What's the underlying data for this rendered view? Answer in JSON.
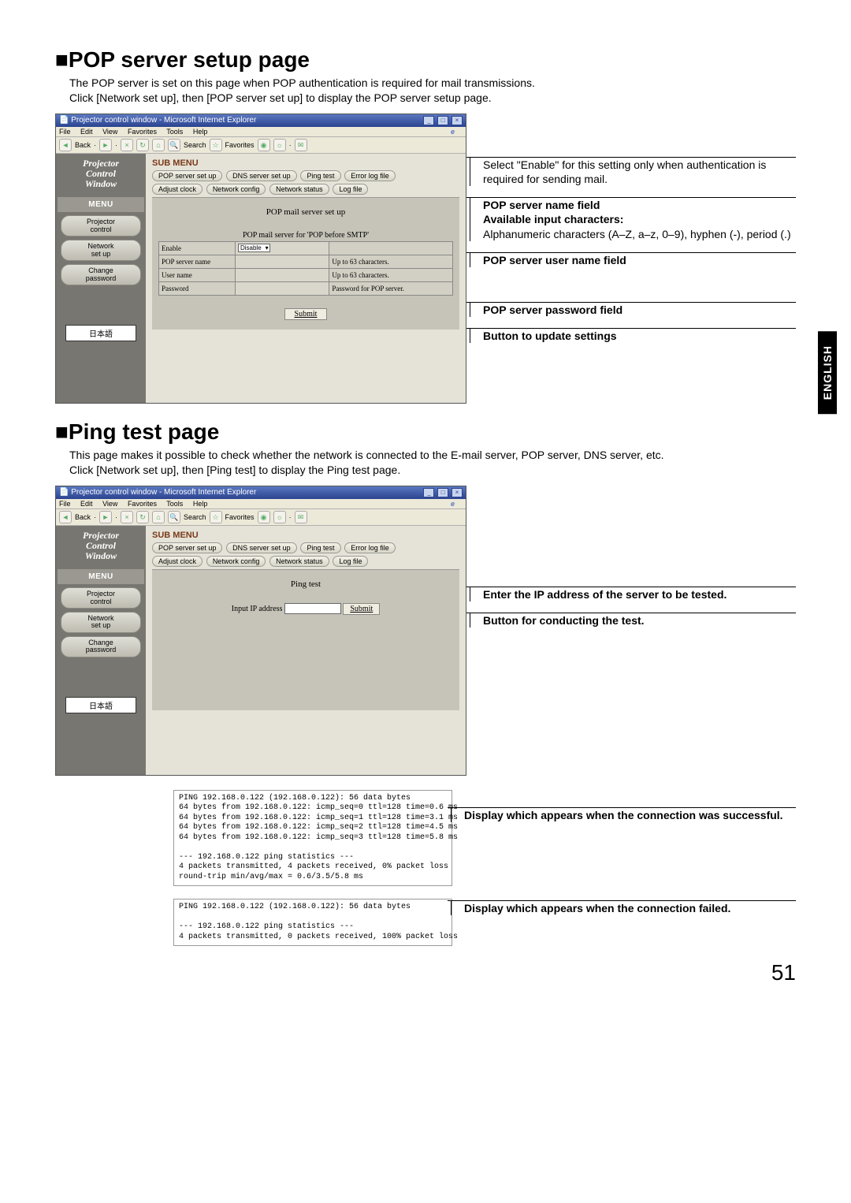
{
  "page": {
    "number": "51",
    "language_tab": "ENGLISH"
  },
  "section1": {
    "heading_prefix": "■",
    "heading": "POP server setup page",
    "intro": "The POP server is set on this page when POP authentication is required for mail transmissions.\nClick [Network set up], then [POP server set up] to display the POP server setup page.",
    "annotations": {
      "enable_note": "Select \"Enable\" for this setting only when authentication is required for sending mail.",
      "server_name_head": "POP server name field",
      "avail_head": "Available input characters:",
      "avail_body": "Alphanumeric characters (A–Z, a–z, 0–9), hyphen (-), period (.)",
      "user_field": "POP server user name field",
      "pass_field": "POP server password field",
      "button_update": "Button to update settings"
    },
    "ie": {
      "title": "Projector control window - Microsoft Internet Explorer",
      "menus": [
        "File",
        "Edit",
        "View",
        "Favorites",
        "Tools",
        "Help"
      ],
      "toolbar": {
        "back": "Back",
        "search": "Search",
        "favorites": "Favorites"
      }
    },
    "sidebar": {
      "logo": "Projector\nControl\nWindow",
      "menu_head": "MENU",
      "items": {
        "control": "Projector\ncontrol",
        "network": "Network\nset up",
        "change": "Change\npassword"
      },
      "lang": "日本語"
    },
    "submenu": {
      "head": "SUB MENU",
      "row1": [
        "POP server set up",
        "DNS server set up",
        "Ping test",
        "Error log file"
      ],
      "row2": [
        "Adjust clock",
        "Network config",
        "Network status",
        "Log file"
      ]
    },
    "panel": {
      "title": "POP mail server set up",
      "section_title": "POP mail server for 'POP before SMTP'",
      "rows": {
        "enable": {
          "label": "Enable",
          "value": "Disable",
          "hint": ""
        },
        "server": {
          "label": "POP server name",
          "value": "",
          "hint": "Up to 63 characters."
        },
        "user": {
          "label": "User name",
          "value": "",
          "hint": "Up to 63 characters."
        },
        "pass": {
          "label": "Password",
          "value": "",
          "hint": "Password for POP server."
        }
      },
      "submit": "Submit"
    }
  },
  "section2": {
    "heading_prefix": "■",
    "heading": "Ping test page",
    "intro": "This page makes it possible to check whether the network is connected to the E-mail server, POP server, DNS server, etc.\nClick [Network set up], then [Ping test] to display the Ping test page.",
    "panel": {
      "title": "Ping test",
      "ip_label": "Input IP address",
      "submit": "Submit"
    },
    "annotations": {
      "ip_note": "Enter the IP address of the server to be tested.",
      "button_note": "Button for conducting the test.",
      "success_note": "Display which appears when the connection was successful.",
      "fail_note": "Display which appears when the connection failed."
    },
    "ping_success": "PING 192.168.0.122 (192.168.0.122): 56 data bytes\n64 bytes from 192.168.0.122: icmp_seq=0 ttl=128 time=0.6 ms\n64 bytes from 192.168.0.122: icmp_seq=1 ttl=128 time=3.1 ms\n64 bytes from 192.168.0.122: icmp_seq=2 ttl=128 time=4.5 ms\n64 bytes from 192.168.0.122: icmp_seq=3 ttl=128 time=5.8 ms\n\n--- 192.168.0.122 ping statistics ---\n4 packets transmitted, 4 packets received, 0% packet loss\nround-trip min/avg/max = 0.6/3.5/5.8 ms",
    "ping_fail": "PING 192.168.0.122 (192.168.0.122): 56 data bytes\n\n--- 192.168.0.122 ping statistics ---\n4 packets transmitted, 0 packets received, 100% packet loss"
  }
}
